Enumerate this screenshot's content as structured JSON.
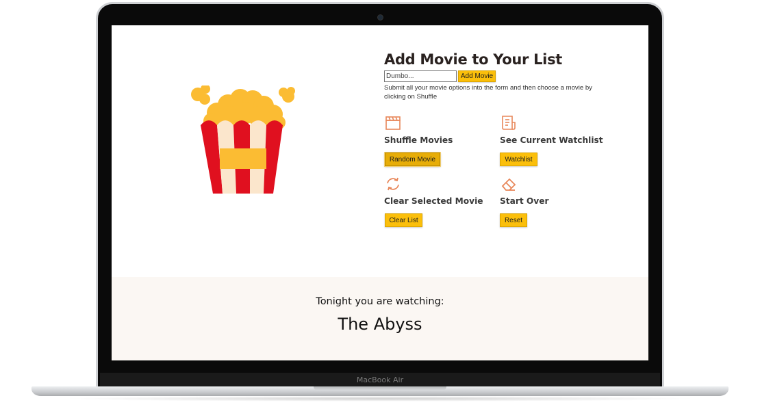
{
  "device": {
    "brand_label": "MacBook Air"
  },
  "form": {
    "title": "Add Movie to Your List",
    "input_placeholder": "Dumbo...",
    "add_button_label": "Add Movie",
    "helper_text": "Submit all your movie options into the form and then choose a movie by clicking on Shuffle"
  },
  "actions": [
    {
      "title": "Shuffle Movies",
      "button_label": "Random Movie",
      "icon": "clapperboard-icon"
    },
    {
      "title": "See Current Watchlist",
      "button_label": "Watchlist",
      "icon": "list-document-icon"
    },
    {
      "title": "Clear Selected Movie",
      "button_label": "Clear List",
      "icon": "refresh-icon"
    },
    {
      "title": "Start Over",
      "button_label": "Reset",
      "icon": "eraser-icon"
    }
  ],
  "result": {
    "label": "Tonight you are watching:",
    "movie": "The Abyss"
  },
  "colors": {
    "accent": "#fbbf0b",
    "icon": "#e8875a",
    "popcorn_red": "#e0101f",
    "popcorn_kernel": "#fbbc33",
    "footer_bg": "#fbf7f3"
  }
}
